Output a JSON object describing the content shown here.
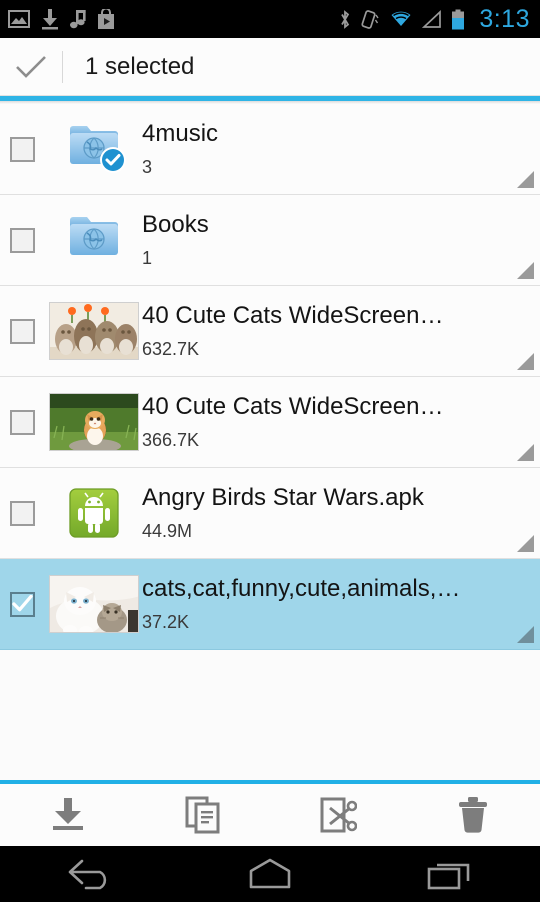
{
  "statusbar": {
    "time": "3:13",
    "left_icons": [
      "gallery-icon",
      "download-icon",
      "music-note-icon",
      "play-store-icon"
    ],
    "right_icons": [
      "bluetooth-icon",
      "vibrate-icon",
      "wifi-icon",
      "cell-signal-icon",
      "battery-icon"
    ],
    "accent_color": "#2ea8e0"
  },
  "actionbar": {
    "done_icon": "checkmark-icon",
    "title": "1 selected",
    "accent_color": "#2eb4e6"
  },
  "files": [
    {
      "name": "4music",
      "size": "3",
      "icon": "folder-globe-icon",
      "type": "folder",
      "checked": false,
      "badge": true,
      "expand_icon": "corner-triangle-icon"
    },
    {
      "name": "Books",
      "size": "1",
      "icon": "folder-globe-icon",
      "type": "folder",
      "checked": false,
      "badge": false,
      "expand_icon": "corner-triangle-icon"
    },
    {
      "name": "40 Cute Cats WideScreen…",
      "size": "632.7K",
      "icon": "image-thumbnail-kittens",
      "type": "image",
      "checked": false,
      "badge": false,
      "expand_icon": "corner-triangle-icon"
    },
    {
      "name": "40 Cute Cats WideScreen…",
      "size": "366.7K",
      "icon": "image-thumbnail-orange-kitten",
      "type": "image",
      "checked": false,
      "badge": false,
      "expand_icon": "corner-triangle-icon"
    },
    {
      "name": "Angry Birds Star Wars.apk",
      "size": "44.9M",
      "icon": "android-apk-icon",
      "type": "apk",
      "checked": false,
      "badge": false,
      "expand_icon": "corner-triangle-icon"
    },
    {
      "name": "cats,cat,funny,cute,animals,…",
      "size": "37.2K",
      "icon": "image-thumbnail-white-cat",
      "type": "image",
      "checked": true,
      "badge": false,
      "expand_icon": "corner-triangle-icon"
    }
  ],
  "toolbar": {
    "separator_color": "#21b0e6",
    "buttons": [
      {
        "icon": "download-icon",
        "label": "Download"
      },
      {
        "icon": "copy-icon",
        "label": "Copy"
      },
      {
        "icon": "cut-icon",
        "label": "Cut"
      },
      {
        "icon": "delete-trash-icon",
        "label": "Delete"
      }
    ]
  },
  "navbar": {
    "buttons": [
      {
        "icon": "back-icon",
        "label": "Back"
      },
      {
        "icon": "home-icon",
        "label": "Home"
      },
      {
        "icon": "recents-icon",
        "label": "Recents"
      }
    ]
  }
}
